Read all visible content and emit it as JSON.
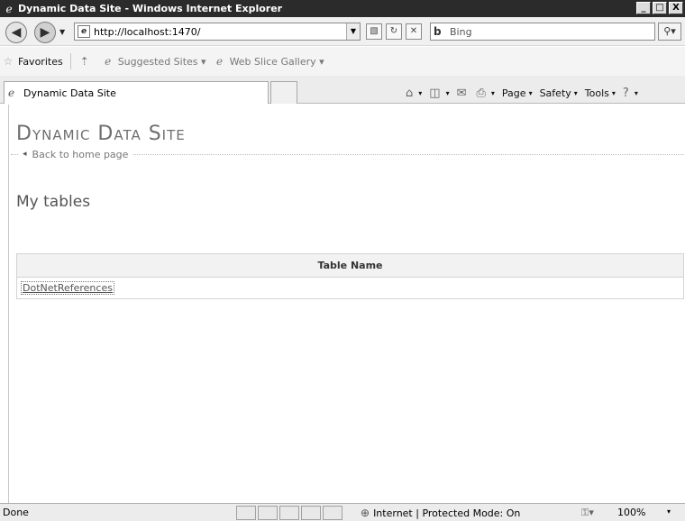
{
  "window": {
    "title": "Dynamic Data Site - Windows Internet Explorer",
    "controls": {
      "minimize": "_",
      "maximize": "□",
      "close": "X"
    }
  },
  "address_bar": {
    "url": "http://localhost:1470/",
    "search_placeholder": "Bing"
  },
  "favorites_bar": {
    "favorites_label": "Favorites",
    "items": [
      {
        "label": "Suggested Sites ▾",
        "icon": "ie-page-icon"
      },
      {
        "label": "Web Slice Gallery ▾",
        "icon": "ie-page-icon"
      }
    ]
  },
  "tab": {
    "label": "Dynamic Data Site"
  },
  "command_bar": {
    "page_label": "Page",
    "safety_label": "Safety",
    "tools_label": "Tools"
  },
  "page": {
    "site_title": "Dynamic Data Site",
    "back_link": "Back to home page",
    "section_title": "My tables",
    "table": {
      "header": "Table Name",
      "rows": [
        "DotNetReferences"
      ]
    }
  },
  "status_bar": {
    "status": "Done",
    "zone": "Internet | Protected Mode: On",
    "zoom": "100%"
  },
  "colors": {
    "title_bar": "#2b2b2b",
    "chrome": "#f0f0f0",
    "site_title": "#6e6e6e"
  }
}
